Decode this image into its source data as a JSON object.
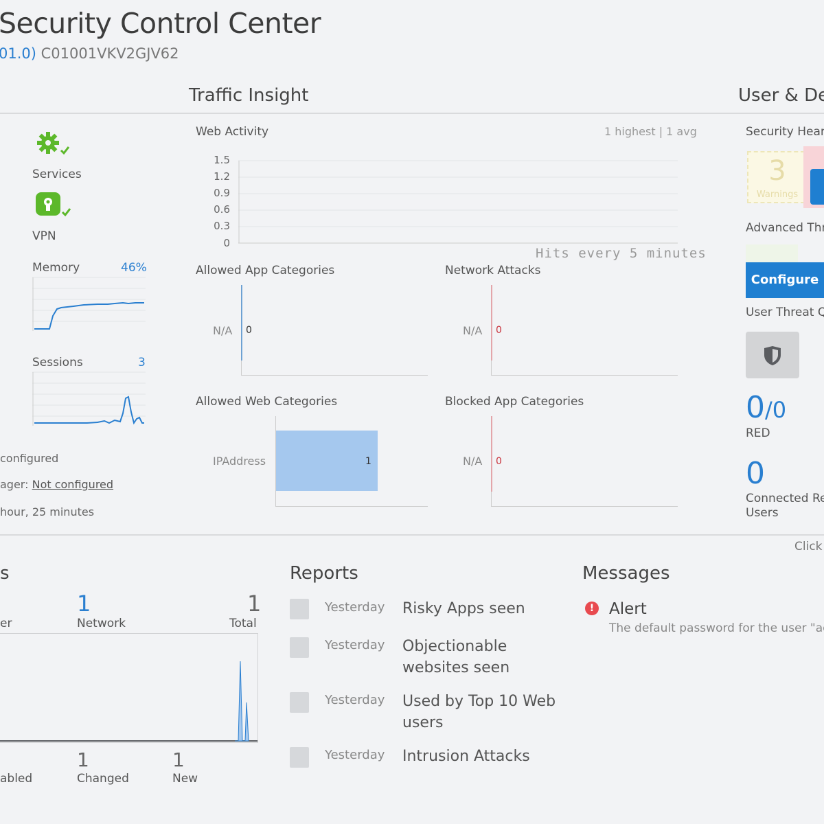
{
  "header": {
    "title": "Security Control Center",
    "version": "01.0)",
    "serial": "C01001VKV2GJV62"
  },
  "system": {
    "services_label": "Services",
    "vpn_label": "VPN",
    "memory_label": "Memory",
    "memory_value": "46%",
    "sessions_label": "Sessions",
    "sessions_value": "3",
    "line1": "configured",
    "line2_prefix": "ager:",
    "line2_link": "Not configured",
    "line3": "hour, 25 minutes"
  },
  "traffic": {
    "title": "Traffic Insight",
    "web_activity": {
      "label": "Web Activity",
      "stats": "1 highest | 1 avg",
      "caption": "Hits every 5 minutes",
      "y_ticks": [
        "1.5",
        "1.2",
        "0.9",
        "0.6",
        "0.3",
        "0"
      ]
    },
    "allowed_app": {
      "label": "Allowed App Categories",
      "cat": "N/A",
      "value": "0"
    },
    "network_attacks": {
      "label": "Network Attacks",
      "cat": "N/A",
      "value": "0"
    },
    "allowed_web": {
      "label": "Allowed Web Categories",
      "cat": "IPAddress",
      "value": "1"
    },
    "blocked_app": {
      "label": "Blocked App Categories",
      "cat": "N/A",
      "value": "0"
    }
  },
  "user_devices": {
    "title": "User & De",
    "heartbeat_label": "Security Heart",
    "warning_count": "3",
    "warning_label": "Warnings",
    "atp_label": "Advanced Thre",
    "configure_label": "Configure",
    "utq_label": "User Threat Q",
    "red_main": "0",
    "red_sub": "/0",
    "red_label": "RED",
    "connected_value": "0",
    "connected_label_1": "Connected Re",
    "connected_label_2": "Users"
  },
  "click_hint": "Click",
  "left_panel": {
    "title_fragment": "s",
    "col1_label": "er",
    "network_value": "1",
    "network_label": "Network",
    "total_value": "1",
    "total_label": "Total",
    "disabled_label": "abled",
    "changed_value": "1",
    "changed_label": "Changed",
    "new_value": "1",
    "new_label": "New"
  },
  "reports": {
    "title": "Reports",
    "items": [
      {
        "time": "Yesterday",
        "text": "Risky Apps seen"
      },
      {
        "time": "Yesterday",
        "text": "Objectionable websites seen"
      },
      {
        "time": "Yesterday",
        "text": "Used by Top 10 Web users"
      },
      {
        "time": "Yesterday",
        "text": "Intrusion Attacks"
      }
    ]
  },
  "messages": {
    "title": "Messages",
    "alert_title": "Alert",
    "alert_text": "The default password for the user \"ad"
  },
  "colors": {
    "accent": "#2a7fd0",
    "alert": "#e84a4f",
    "ok_green": "#5cb82a",
    "bar_fill": "#a5c8ee"
  }
}
